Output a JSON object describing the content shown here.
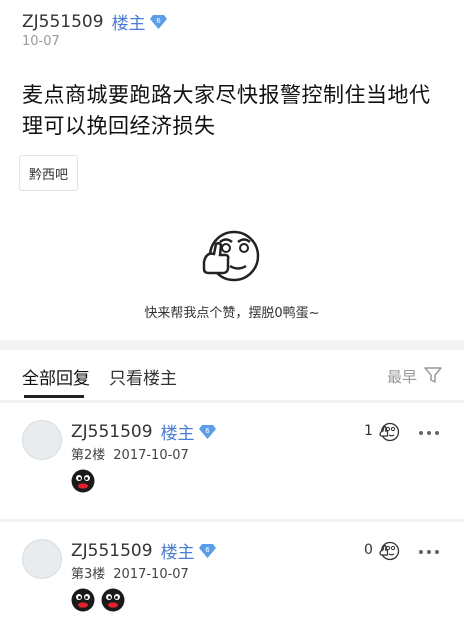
{
  "post": {
    "author": "ZJ551509",
    "author_tag": "楼主",
    "badge_level": "6",
    "date": "10-07",
    "title": "麦点商城要跑路大家尽快报警控制住当地代理可以挽回经济损失",
    "forum": "黔西吧",
    "like_prompt": "快来帮我点个赞，摆脱0鸭蛋~"
  },
  "tabs": {
    "all": "全部回复",
    "op_only": "只看楼主",
    "sort": "最早"
  },
  "replies": [
    {
      "author": "ZJ551509",
      "author_tag": "楼主",
      "badge_level": "6",
      "floor": "第2楼",
      "date": "2017-10-07",
      "likes": "1",
      "emojis": [
        "black-face-emoji"
      ]
    },
    {
      "author": "ZJ551509",
      "author_tag": "楼主",
      "badge_level": "6",
      "floor": "第3楼",
      "date": "2017-10-07",
      "likes": "0",
      "emojis": [
        "black-face-emoji",
        "black-face-emoji"
      ]
    }
  ],
  "colors": {
    "accent": "#4a7dd4",
    "badge": "#5b9ee8"
  }
}
